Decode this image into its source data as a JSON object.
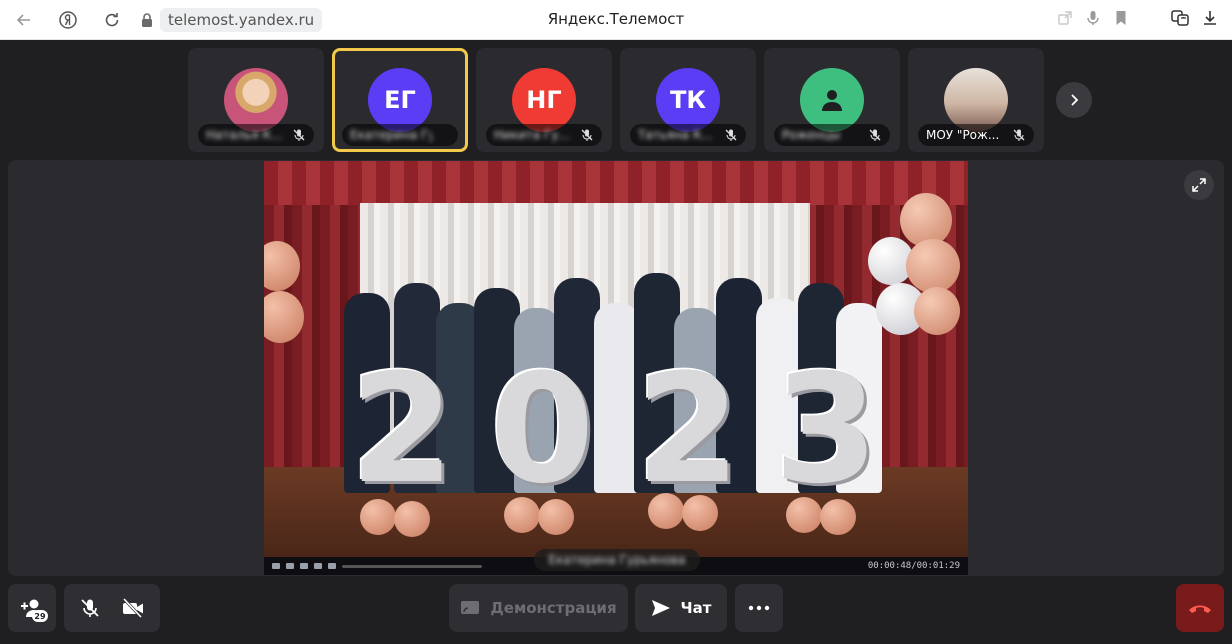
{
  "browser": {
    "url": "telemost.yandex.ru",
    "page_title": "Яндекс.Телемост"
  },
  "participants": [
    {
      "initials": "",
      "name": "Наталья К...",
      "avatar": "photo",
      "color": ""
    },
    {
      "initials": "ЕГ",
      "name": "Екатерина Гу...",
      "avatar": "initials",
      "color": "#5b3df5",
      "active": true
    },
    {
      "initials": "НГ",
      "name": "Никита Гу...",
      "avatar": "initials",
      "color": "#ef3b33"
    },
    {
      "initials": "ТК",
      "name": "Татьяна К...",
      "avatar": "initials",
      "color": "#5b3df5"
    },
    {
      "initials": "",
      "name": "Роженцы",
      "avatar": "person-icon",
      "color": "#3fbf7f"
    },
    {
      "initials": "",
      "name": "МОУ \"Рож...",
      "avatar": "photo",
      "color": ""
    }
  ],
  "stage": {
    "speaker_name": "Екатерина Гурьянова",
    "video_year": [
      "2",
      "0",
      "2",
      "3"
    ],
    "timecode": "00:00:48/00:01:29"
  },
  "toolbar": {
    "invite_count": "29",
    "demo_label": "Демонстрация",
    "chat_label": "Чат"
  },
  "colors": {
    "background": "#1f1f22",
    "tile": "#2b2b2f",
    "active_border": "#f3c94a",
    "end_call": "#7a1b1b"
  }
}
